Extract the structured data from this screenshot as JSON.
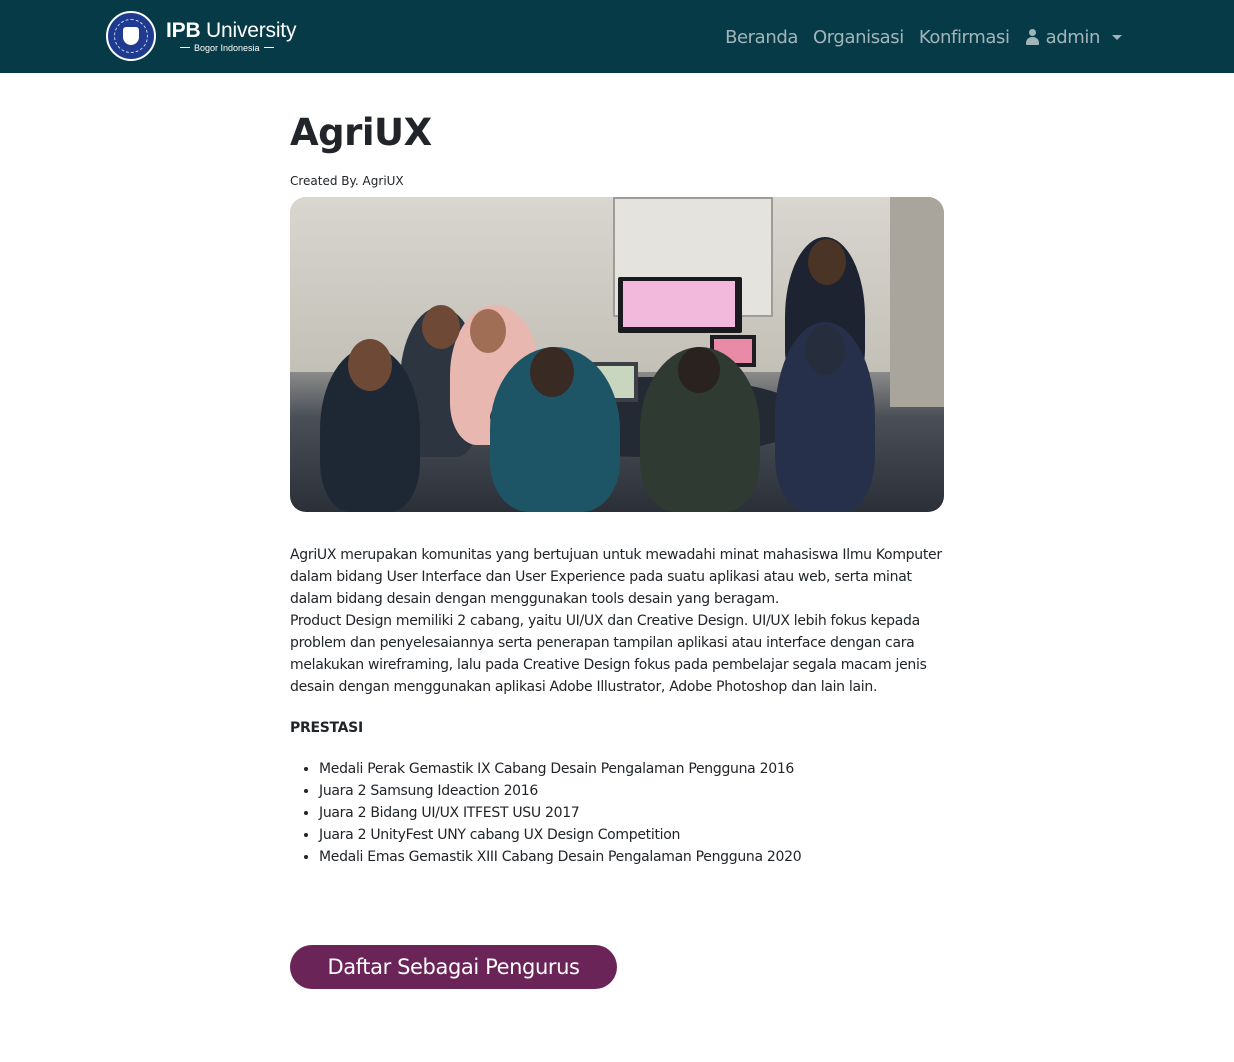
{
  "navbar": {
    "brand": {
      "name_bold": "IPB",
      "name_rest": " University",
      "subtitle": "Bogor Indonesia"
    },
    "links": [
      {
        "label": "Beranda"
      },
      {
        "label": "Organisasi"
      },
      {
        "label": "Konfirmasi"
      }
    ],
    "user": {
      "label": "admin",
      "icon": "user-icon"
    }
  },
  "main": {
    "title": "AgriUX",
    "created_by": "Created By. AgriUX",
    "description": [
      "AgriUX merupakan komunitas yang bertujuan untuk mewadahi minat mahasiswa Ilmu Komputer dalam bidang User Interface dan User Experience pada suatu aplikasi atau web, serta minat dalam bidang desain dengan menggunakan tools desain yang beragam.",
      "Product Design memiliki 2 cabang, yaitu UI/UX dan Creative Design. UI/UX lebih fokus kepada problem dan penyelesaiannya serta penerapan tampilan aplikasi atau interface dengan cara melakukan wireframing, lalu pada Creative Design fokus pada pembelajar segala macam jenis desain dengan menggunakan aplikasi Adobe Illustrator, Adobe Photoshop dan lain lain."
    ],
    "prestasi_title": "PRESTASI",
    "prestasi": [
      "Medali Perak Gemastik IX Cabang Desain Pengalaman Pengguna 2016",
      "Juara 2 Samsung Ideaction 2016",
      "Juara 2 Bidang UI/UX ITFEST USU 2017",
      "Juara 2 UnityFest UNY cabang UX Design Competition",
      "Medali Emas Gemastik XIII Cabang Desain Pengalaman Pengguna 2020"
    ],
    "cta_label": "Daftar Sebagai Pengurus"
  },
  "colors": {
    "navbar_bg": "#063a47",
    "cta_bg": "#6b2458"
  }
}
